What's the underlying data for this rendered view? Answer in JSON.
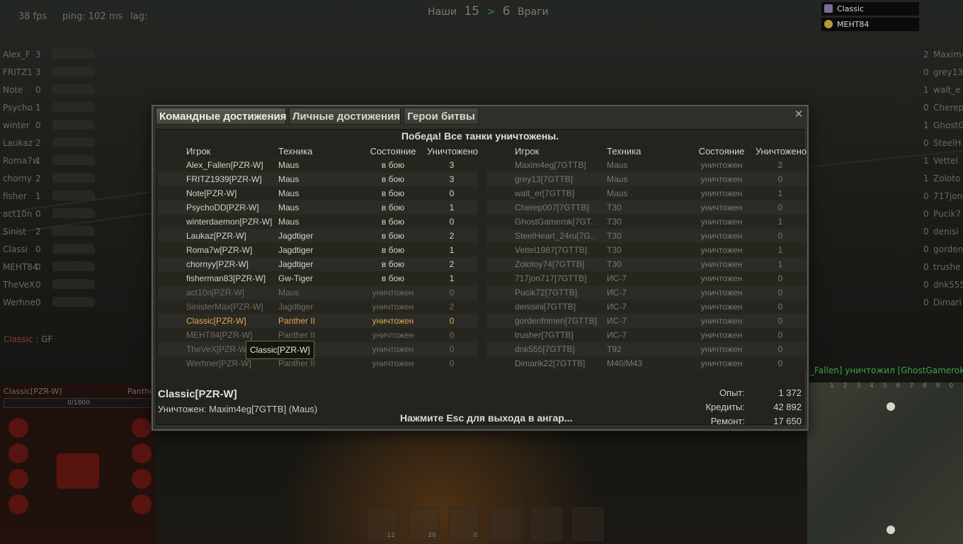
{
  "hud": {
    "fps": "38 fps",
    "ping": "ping: 102 ms",
    "lag": "lag:",
    "score": {
      "ours_label": "Наши",
      "ours": "15",
      "arrow": ">",
      "theirs": "6",
      "theirs_label": "Враги"
    }
  },
  "left_panel": [
    {
      "name": "Alex_F",
      "frags": "3"
    },
    {
      "name": "FRITZ1",
      "frags": "3"
    },
    {
      "name": "Note",
      "frags": "0"
    },
    {
      "name": "Psycho",
      "frags": "1"
    },
    {
      "name": "winter",
      "frags": "0"
    },
    {
      "name": "Laukaz",
      "frags": "2"
    },
    {
      "name": "Roma7w",
      "frags": "1"
    },
    {
      "name": "chorny",
      "frags": "2"
    },
    {
      "name": "fisher",
      "frags": "1"
    },
    {
      "name": "act10n",
      "frags": "0"
    },
    {
      "name": "Sinist",
      "frags": "2"
    },
    {
      "name": "Classi",
      "frags": "0"
    },
    {
      "name": "MEHT84",
      "frags": "0"
    },
    {
      "name": "TheVeX",
      "frags": "0"
    },
    {
      "name": "Werhne",
      "frags": "0"
    }
  ],
  "right_panel": [
    {
      "name": "Maxim4",
      "frags": "2"
    },
    {
      "name": "grey13",
      "frags": "0"
    },
    {
      "name": "walt_e",
      "frags": "1"
    },
    {
      "name": "Cherep",
      "frags": "0"
    },
    {
      "name": "GhostG",
      "frags": "1"
    },
    {
      "name": "SteelH",
      "frags": "0"
    },
    {
      "name": "Vettel",
      "frags": "1"
    },
    {
      "name": "Zoloto",
      "frags": "1"
    },
    {
      "name": "717jon",
      "frags": "0"
    },
    {
      "name": "Pucik7",
      "frags": "0"
    },
    {
      "name": "denisi",
      "frags": "0"
    },
    {
      "name": "gorden",
      "frags": "0"
    },
    {
      "name": "trushe",
      "frags": "0"
    },
    {
      "name": "dnk555",
      "frags": "0"
    },
    {
      "name": "Dimari",
      "frags": "0"
    }
  ],
  "platoon": [
    "Classic",
    "MEHT84"
  ],
  "chat_channel": {
    "name": "Classic",
    "sep": " : ",
    "text": "GF"
  },
  "kill_message": "_Fallen] уничтожил [GhostGamerok]",
  "minimap_cols": "1234567890",
  "player_hud": {
    "name": "Classic[PZR-W]",
    "tank": "Panther",
    "hp": "0/1800"
  },
  "ammo": [
    {
      "count": "12"
    },
    {
      "count": "26"
    },
    {
      "count": "0"
    }
  ],
  "dialog": {
    "tabs": [
      "Командные достижения",
      "Личные достижения",
      "Герои битвы"
    ],
    "close": "✕",
    "result": "Победа! Все танки уничтожены.",
    "headers": {
      "player": "Игрок",
      "vehicle": "Техника",
      "state": "Состояние",
      "kills": "Уничтожено"
    },
    "ally_rows": [
      {
        "player": "Alex_Fallen[PZR-W]",
        "vehicle": "Maus",
        "state": "в бою",
        "kills": "3",
        "status": "alive"
      },
      {
        "player": "FRITZ1939[PZR-W]",
        "vehicle": "Maus",
        "state": "в бою",
        "kills": "3",
        "status": "alive"
      },
      {
        "player": "Note[PZR-W]",
        "vehicle": "Maus",
        "state": "в бою",
        "kills": "0",
        "status": "alive"
      },
      {
        "player": "PsychoDD[PZR-W]",
        "vehicle": "Maus",
        "state": "в бою",
        "kills": "1",
        "status": "alive"
      },
      {
        "player": "winterdaemon[PZR-W]",
        "vehicle": "Maus",
        "state": "в бою",
        "kills": "0",
        "status": "alive"
      },
      {
        "player": "Laukaz[PZR-W]",
        "vehicle": "Jagdtiger",
        "state": "в бою",
        "kills": "2",
        "status": "alive"
      },
      {
        "player": "Roma7w[PZR-W]",
        "vehicle": "Jagdtiger",
        "state": "в бою",
        "kills": "1",
        "status": "alive"
      },
      {
        "player": "chornyy[PZR-W]",
        "vehicle": "Jagdtiger",
        "state": "в бою",
        "kills": "2",
        "status": "alive"
      },
      {
        "player": "fisherman83[PZR-W]",
        "vehicle": "Gw-Tiger",
        "state": "в бою",
        "kills": "1",
        "status": "alive"
      },
      {
        "player": "act10n[PZR-W]",
        "vehicle": "Maus",
        "state": "уничтожен",
        "kills": "0",
        "status": "dead"
      },
      {
        "player": "SinisterMax[PZR-W]",
        "vehicle": "Jagdtiger",
        "state": "уничтожен",
        "kills": "2",
        "status": "dead"
      },
      {
        "player": "Classic[PZR-W]",
        "vehicle": "Panther II",
        "state": "уничтожен",
        "kills": "0",
        "status": "self"
      },
      {
        "player": "MEHT84[PZR-W]",
        "vehicle": "Panther II",
        "state": "уничтожен",
        "kills": "0",
        "status": "dead"
      },
      {
        "player": "TheVeX[PZR-W]",
        "vehicle": "Panther II",
        "state": "уничтожен",
        "kills": "0",
        "status": "dead"
      },
      {
        "player": "Werhner[PZR-W]",
        "vehicle": "Panther II",
        "state": "уничтожен",
        "kills": "0",
        "status": "dead"
      }
    ],
    "enemy_rows": [
      {
        "player": "Maxim4eg[7GTTB]",
        "vehicle": "Maus",
        "state": "уничтожен",
        "kills": "2"
      },
      {
        "player": "grey13[7GTTB]",
        "vehicle": "Maus",
        "state": "уничтожен",
        "kills": "0"
      },
      {
        "player": "walt_er[7GTTB]",
        "vehicle": "Maus",
        "state": "уничтожен",
        "kills": "1"
      },
      {
        "player": "Cherep007[7GTTB]",
        "vehicle": "T30",
        "state": "уничтожен",
        "kills": "0"
      },
      {
        "player": "GhostGamerok[7GT..",
        "vehicle": "T30",
        "state": "уничтожен",
        "kills": "1"
      },
      {
        "player": "SteelHeart_24ru[7G..",
        "vehicle": "T30",
        "state": "уничтожен",
        "kills": "0"
      },
      {
        "player": "Vettel1987[7GTTB]",
        "vehicle": "T30",
        "state": "уничтожен",
        "kills": "1"
      },
      {
        "player": "Zolotoy74[7GTTB]",
        "vehicle": "T30",
        "state": "уничтожен",
        "kills": "1"
      },
      {
        "player": "717jon717[7GTTB]",
        "vehicle": "ИС-7",
        "state": "уничтожен",
        "kills": "0"
      },
      {
        "player": "Pucik72[7GTTB]",
        "vehicle": "ИС-7",
        "state": "уничтожен",
        "kills": "0"
      },
      {
        "player": "denisini[7GTTB]",
        "vehicle": "ИС-7",
        "state": "уничтожен",
        "kills": "0"
      },
      {
        "player": "gordenfrimen[7GTTB]",
        "vehicle": "ИС-7",
        "state": "уничтожен",
        "kills": "0"
      },
      {
        "player": "trusher[7GTTB]",
        "vehicle": "ИС-7",
        "state": "уничтожен",
        "kills": "0"
      },
      {
        "player": "dnk555[7GTTB]",
        "vehicle": "T92",
        "state": "уничтожен",
        "kills": "0"
      },
      {
        "player": "Dimarik22[7GTTB]",
        "vehicle": "M40/M43",
        "state": "уничтожен",
        "kills": "0"
      }
    ],
    "tooltip": "Classic[PZR-W]",
    "footer": {
      "player": "Classic[PZR-W]",
      "killed_by": "Уничтожен: Maxim4eg[7GTTB] (Maus)",
      "esc_hint": "Нажмите Esc для выхода в ангар...",
      "stats": [
        {
          "label": "Опыт:",
          "value": "1 372"
        },
        {
          "label": "Кредиты:",
          "value": "42 892"
        },
        {
          "label": "Ремонт:",
          "value": "17 650"
        }
      ]
    }
  },
  "colors": {
    "self": "#e6a84a",
    "alive": "#d6d3c6",
    "dead": "#6e6d66",
    "kill_msg": "#3fa34a"
  }
}
